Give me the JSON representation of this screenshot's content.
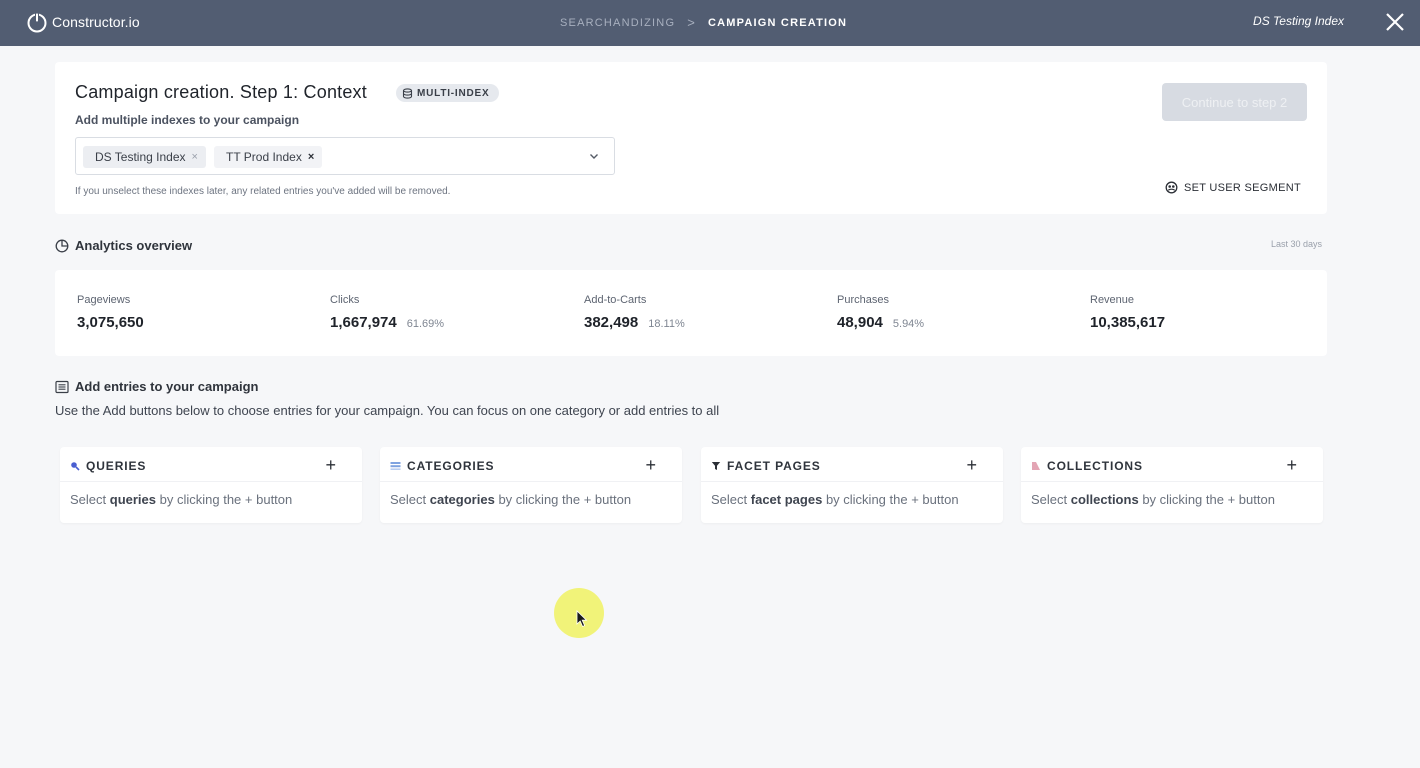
{
  "topbar": {
    "brand": "Constructor.io",
    "breadcrumb_prev": "SEARCHANDIZING",
    "breadcrumb_sep": ">",
    "breadcrumb_current": "CAMPAIGN CREATION",
    "index_name": "DS Testing Index",
    "icons": {
      "logo": "power-icon",
      "close": "close-icon"
    },
    "bg_color": "#525d72"
  },
  "context": {
    "title": "Campaign creation. Step 1: Context",
    "badge": "MULTI-INDEX",
    "subtitle": "Add multiple indexes to your campaign",
    "chips": [
      {
        "label": "DS Testing Index",
        "remove": "×"
      },
      {
        "label": "TT Prod Index",
        "remove": "×"
      }
    ],
    "note": "If you unselect these indexes later, any related entries you've added will be removed.",
    "continue_label": "Continue to step 2",
    "segment_label": "SET USER SEGMENT"
  },
  "analytics": {
    "title": "Analytics overview",
    "period": "Last 30 days",
    "metrics": [
      {
        "label": "Pageviews",
        "value": "3,075,650",
        "pct": ""
      },
      {
        "label": "Clicks",
        "value": "1,667,974",
        "pct": "61.69%"
      },
      {
        "label": "Add-to-Carts",
        "value": "382,498",
        "pct": "18.11%"
      },
      {
        "label": "Purchases",
        "value": "48,904",
        "pct": "5.94%"
      },
      {
        "label": "Revenue",
        "value": "10,385,617",
        "pct": ""
      }
    ]
  },
  "entries": {
    "title": "Add entries to your campaign",
    "description": "Use the Add buttons below to choose entries for your campaign. You can focus on one category or add entries to all",
    "hint_prefix": "Select",
    "hint_suffix": "by clicking the + button",
    "add_symbol": "+",
    "cards": [
      {
        "title": "QUERIES",
        "keyword": "queries",
        "icon": "search-icon",
        "icon_color": "#4a5fd1"
      },
      {
        "title": "CATEGORIES",
        "keyword": "categories",
        "icon": "list-icon",
        "icon_color": "#7fa3e0"
      },
      {
        "title": "FACET PAGES",
        "keyword": "facet pages",
        "icon": "funnel-icon",
        "icon_color": "#2b2f36"
      },
      {
        "title": "COLLECTIONS",
        "keyword": "collections",
        "icon": "tag-icon",
        "icon_color": "#e3a5b4"
      }
    ]
  }
}
